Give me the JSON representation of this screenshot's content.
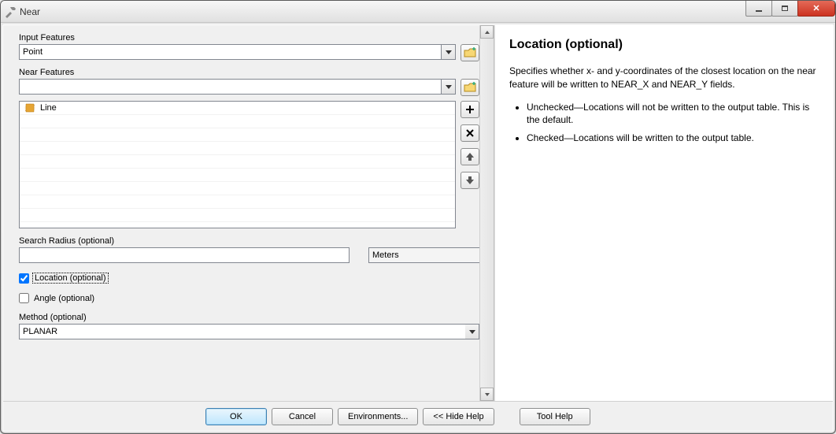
{
  "window": {
    "title": "Near"
  },
  "form": {
    "input_features_label": "Input Features",
    "input_features_value": "Point",
    "near_features_label": "Near Features",
    "near_features_value": "",
    "near_list": [
      {
        "icon": "line-feature-icon",
        "label": "Line"
      }
    ],
    "search_radius_label": "Search Radius (optional)",
    "search_radius_value": "",
    "units_value": "Meters",
    "location_checked": true,
    "location_label": "Location (optional)",
    "angle_checked": false,
    "angle_label": "Angle (optional)",
    "method_label": "Method (optional)",
    "method_value": "PLANAR"
  },
  "help": {
    "title": "Location (optional)",
    "p1": "Specifies whether x- and y-coordinates of the closest location on the near feature will be written to NEAR_X and NEAR_Y fields.",
    "li1": "Unchecked—Locations will not be written to the output table. This is the default.",
    "li2": "Checked—Locations will be written to the output table."
  },
  "buttons": {
    "ok": "OK",
    "cancel": "Cancel",
    "env": "Environments...",
    "hide_help": "<< Hide Help",
    "tool_help": "Tool Help"
  }
}
